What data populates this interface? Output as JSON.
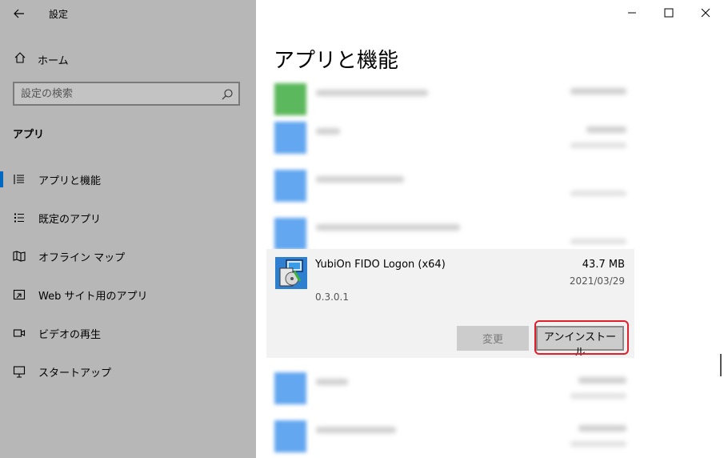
{
  "window": {
    "title": "設定",
    "controls": {
      "minimize": "minimize-icon",
      "maximize": "maximize-icon",
      "close": "close-icon"
    }
  },
  "sidebar": {
    "home_label": "ホーム",
    "search_placeholder": "設定の検索",
    "section_title": "アプリ",
    "items": [
      {
        "label": "アプリと機能",
        "icon": "apps-list-icon",
        "selected": true
      },
      {
        "label": "既定のアプリ",
        "icon": "default-apps-icon",
        "selected": false
      },
      {
        "label": "オフライン マップ",
        "icon": "map-icon",
        "selected": false
      },
      {
        "label": "Web サイト用のアプリ",
        "icon": "website-apps-icon",
        "selected": false
      },
      {
        "label": "ビデオの再生",
        "icon": "video-icon",
        "selected": false
      },
      {
        "label": "スタートアップ",
        "icon": "startup-icon",
        "selected": false
      }
    ]
  },
  "main": {
    "page_title": "アプリと機能",
    "selected_app": {
      "name": "YubiOn FIDO Logon (x64)",
      "size": "43.7 MB",
      "date": "2021/03/29",
      "version": "0.3.0.1",
      "modify_label": "変更",
      "uninstall_label": "アンインストール"
    }
  },
  "colors": {
    "accent": "#0067c0",
    "highlight": "#e0202a",
    "sidebar_bg": "#b7b7b7"
  }
}
